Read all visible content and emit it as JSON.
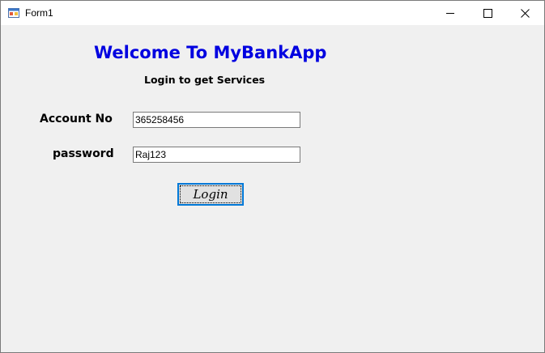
{
  "window": {
    "title": "Form1",
    "app_icon": "form-app-icon",
    "controls": {
      "minimize_icon": "minimize-icon",
      "maximize_icon": "maximize-icon",
      "close_icon": "close-icon"
    }
  },
  "form": {
    "welcome": "Welcome To MyBankApp",
    "subtitle": "Login to get Services",
    "account_label": "Account No",
    "account_value": "365258456",
    "password_label": "password",
    "password_value": "Raj123",
    "login_label": "Login"
  },
  "colors": {
    "welcome_text": "#0000e0",
    "button_focus_border": "#0078d7",
    "client_background": "#f0f0f0"
  }
}
